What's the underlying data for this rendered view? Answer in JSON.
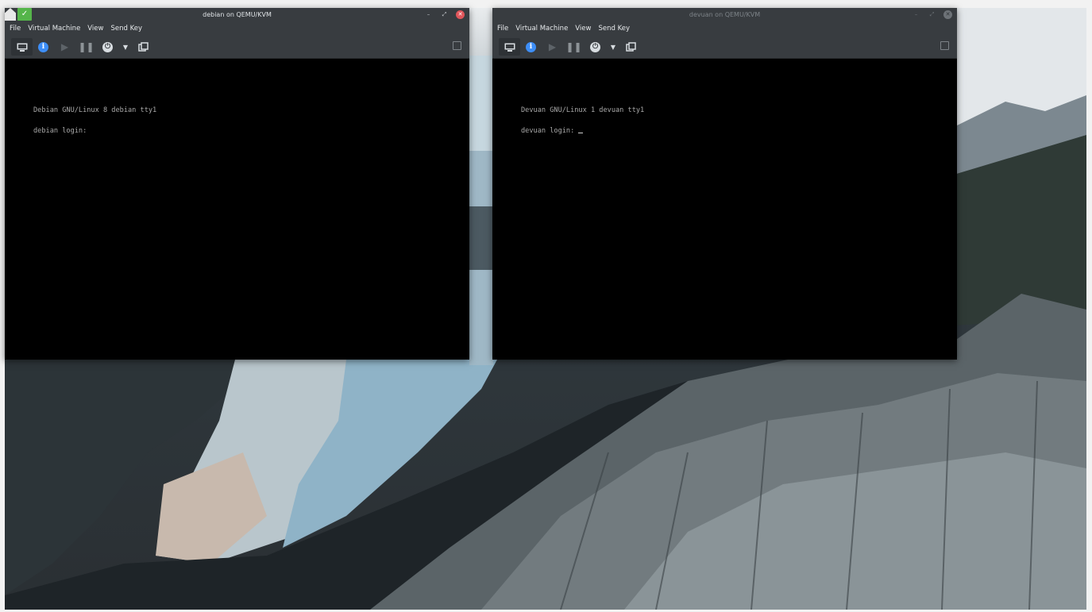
{
  "desktop": {
    "wallpaper": "glacier mountain landscape"
  },
  "windows": [
    {
      "id": "debian",
      "title": "debian on QEMU/KVM",
      "active": true,
      "menu": [
        "File",
        "Virtual Machine",
        "View",
        "Send Key"
      ],
      "toolbar": [
        "monitor-icon",
        "info-icon",
        "play-icon",
        "pause-icon",
        "power-icon",
        "chevron-down-icon",
        "clone-icon"
      ],
      "controls": [
        "minimize",
        "maximize",
        "close"
      ],
      "console": [
        "Debian GNU/Linux 8 debian tty1",
        "debian login:"
      ]
    },
    {
      "id": "devuan",
      "title": "devuan on QEMU/KVM",
      "active": false,
      "menu": [
        "File",
        "Virtual Machine",
        "View",
        "Send Key"
      ],
      "toolbar": [
        "monitor-icon",
        "info-icon",
        "play-icon",
        "pause-icon",
        "power-icon",
        "chevron-down-icon",
        "clone-icon"
      ],
      "controls": [
        "minimize",
        "maximize",
        "close"
      ],
      "console": [
        "Devuan GNU/Linux 1 devuan tty1",
        "devuan login: "
      ]
    }
  ],
  "colors": {
    "chrome": "#383c40",
    "accent_info": "#3d8ef7",
    "close": "#e0565b",
    "console_bg": "#000000",
    "console_text": "#a8a8a8"
  }
}
